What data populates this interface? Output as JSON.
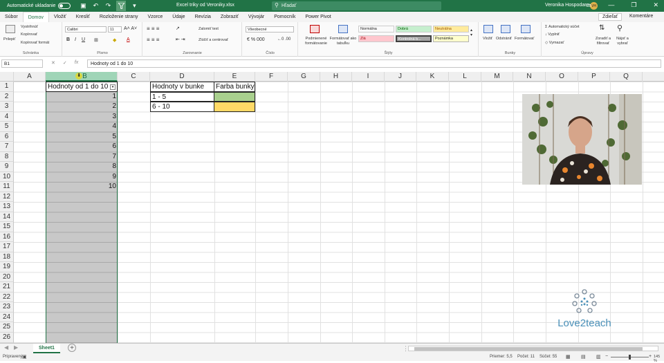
{
  "titlebar": {
    "autosave_label": "Automatické ukladanie",
    "document_title": "Excel triky od Veroniky.xlsx",
    "search_placeholder": "Hľadať",
    "user_name": "Veronika Hospodarova",
    "user_initials": "VH",
    "accent_color": "#217346"
  },
  "menu": {
    "tabs": [
      "Súbor",
      "Domov",
      "Vložiť",
      "Kresliť",
      "Rozloženie strany",
      "Vzorce",
      "Údaje",
      "Revízia",
      "Zobraziť",
      "Vývojár",
      "Pomocník",
      "Power Pivot"
    ],
    "active_tab": "Domov",
    "share_label": "Zdieľať",
    "comments_label": "Komentáre"
  },
  "ribbon": {
    "clipboard": {
      "paste": "Prilepiť",
      "cut": "Vystrihnúť",
      "copy": "Kopírovať",
      "format_painter": "Kopírovať formát",
      "label": "Schránka"
    },
    "font": {
      "name": "Calibri",
      "size": "11",
      "label": "Písmo"
    },
    "alignment": {
      "wrap": "Zalomiť text",
      "merge": "Zlúčiť a centrovať",
      "label": "Zarovnanie"
    },
    "number": {
      "format": "Všeobecné",
      "label": "Číslo"
    },
    "styles": {
      "conditional": "Podmienené formátovanie",
      "as_table": "Formátovať ako tabuľku",
      "items": [
        {
          "name": "Normálna",
          "bg": "#ffffff",
          "fg": "#000000"
        },
        {
          "name": "Dobrá",
          "bg": "#c6efce",
          "fg": "#006100"
        },
        {
          "name": "Neutrálna",
          "bg": "#ffeb9c",
          "fg": "#9c5700"
        },
        {
          "name": "Zlá",
          "bg": "#ffc7ce",
          "fg": "#9c0006"
        },
        {
          "name": "Kontrolná b...",
          "bg": "#a5a5a5",
          "fg": "#ffffff"
        },
        {
          "name": "Poznámka",
          "bg": "#ffffcc",
          "fg": "#000000"
        }
      ],
      "label": "Štýly"
    },
    "cells": {
      "insert": "Vložiť",
      "delete": "Odstrániť",
      "format": "Formátovať",
      "label": "Bunky"
    },
    "editing": {
      "autosum": "Automatický súčet",
      "fill": "Vyplniť",
      "clear": "Vymazať",
      "sort": "Zoradiť a filtrovať",
      "find": "Nájsť a vybrať",
      "label": "Úpravy"
    }
  },
  "formula_bar": {
    "name_box": "B1",
    "fx": "fx",
    "formula": "Hodnoty od 1 do 10"
  },
  "grid": {
    "columns": [
      "A",
      "B",
      "C",
      "D",
      "E",
      "F",
      "G",
      "H",
      "I",
      "J",
      "K",
      "L",
      "M",
      "N",
      "O",
      "P",
      "Q"
    ],
    "selected_column": "B",
    "rows": [
      "1",
      "2",
      "3",
      "4",
      "5",
      "6",
      "7",
      "8",
      "9",
      "10",
      "11",
      "12",
      "13",
      "14",
      "15",
      "16",
      "17",
      "18",
      "19",
      "20",
      "21",
      "22",
      "23",
      "24",
      "25",
      "26"
    ],
    "b_header": "Hodnoty od 1 do 10",
    "b_values": [
      "1",
      "2",
      "3",
      "4",
      "5",
      "6",
      "7",
      "8",
      "9",
      "10"
    ],
    "legend": {
      "header_1": "Hodnoty v bunke",
      "header_2": "Farba bunky",
      "rows": [
        {
          "range": "1 - 5",
          "color": "#a9d08e"
        },
        {
          "range": "6 - 10",
          "color": "#ffd966"
        }
      ]
    }
  },
  "logo": {
    "text": "Love2teach",
    "color": "#4a90b8"
  },
  "sheets": {
    "tabs": [
      "Sheet1"
    ],
    "active": "Sheet1"
  },
  "status": {
    "mode": "Pripravený",
    "average": "Priemer: 5,5",
    "count": "Počet: 11",
    "sum": "Súčet: 55",
    "zoom": "145 %"
  }
}
